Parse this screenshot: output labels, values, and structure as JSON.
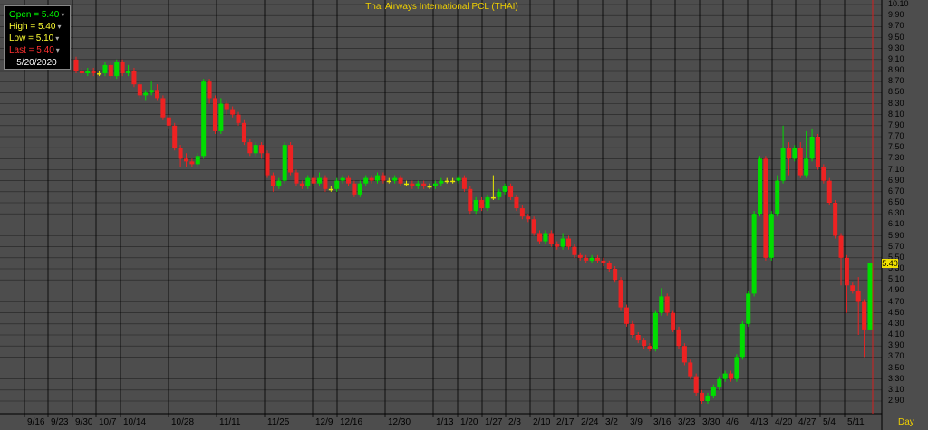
{
  "title": "Thai Airways International PCL (THAI)",
  "info": {
    "open": "Open = 5.40",
    "high": "High = 5.40",
    "low": "Low = 5.10",
    "last": "Last = 5.40",
    "date": "5/20/2020"
  },
  "colors": {
    "background": "#4d4d4d",
    "grid": "#000000",
    "up": "#00dd00",
    "down": "#ee2222",
    "doji": "#e8e800",
    "open": "#00ff00",
    "high": "#ffff33",
    "low": "#ffff33",
    "last": "#ff3030"
  },
  "period_label": "Day",
  "last_price_badge": "5.40",
  "chart_data": {
    "type": "candlestick",
    "title": "Thai Airways International PCL (THAI)",
    "ylim": [
      2.8,
      10.1
    ],
    "y_ticks": [
      "10.10",
      "9.90",
      "9.70",
      "9.50",
      "9.30",
      "9.10",
      "8.90",
      "8.70",
      "8.50",
      "8.30",
      "8.10",
      "7.90",
      "7.70",
      "7.50",
      "7.30",
      "7.10",
      "6.90",
      "6.70",
      "6.50",
      "6.30",
      "6.10",
      "5.90",
      "5.70",
      "5.50",
      "5.30",
      "5.10",
      "4.90",
      "4.70",
      "4.50",
      "4.30",
      "4.10",
      "3.90",
      "3.70",
      "3.50",
      "3.30",
      "3.10",
      "2.90"
    ],
    "x_ticks": [
      "9/16",
      "9/23",
      "9/30",
      "10/7",
      "10/14",
      "10/28",
      "11/11",
      "11/25",
      "12/9",
      "12/16",
      "12/30",
      "1/13",
      "1/20",
      "1/27",
      "2/3",
      "2/10",
      "2/17",
      "2/24",
      "3/2",
      "3/9",
      "3/16",
      "3/23",
      "3/30",
      "4/6",
      "4/13",
      "4/20",
      "4/27",
      "5/4",
      "5/11"
    ],
    "candles": [
      [
        9.1,
        8.9,
        9.15,
        8.85
      ],
      [
        8.9,
        8.85,
        8.95,
        8.8
      ],
      [
        8.85,
        8.9,
        8.95,
        8.8
      ],
      [
        8.9,
        8.85,
        8.95,
        8.8
      ],
      [
        8.85,
        8.85,
        8.9,
        8.8
      ],
      [
        8.85,
        9.0,
        9.05,
        8.8
      ],
      [
        9.0,
        8.8,
        9.05,
        8.75
      ],
      [
        8.8,
        9.05,
        9.1,
        8.75
      ],
      [
        9.05,
        8.85,
        9.1,
        8.8
      ],
      [
        8.85,
        8.9,
        9.0,
        8.8
      ],
      [
        8.9,
        8.65,
        8.95,
        8.6
      ],
      [
        8.65,
        8.45,
        8.7,
        8.4
      ],
      [
        8.45,
        8.5,
        8.55,
        8.35
      ],
      [
        8.5,
        8.55,
        8.7,
        8.45
      ],
      [
        8.55,
        8.4,
        8.65,
        8.35
      ],
      [
        8.4,
        8.05,
        8.45,
        8.0
      ],
      [
        8.05,
        7.9,
        8.1,
        7.85
      ],
      [
        7.9,
        7.5,
        7.95,
        7.45
      ],
      [
        7.5,
        7.3,
        7.55,
        7.15
      ],
      [
        7.3,
        7.25,
        7.4,
        7.15
      ],
      [
        7.25,
        7.2,
        7.3,
        7.15
      ],
      [
        7.2,
        7.35,
        7.4,
        7.15
      ],
      [
        7.35,
        8.7,
        8.75,
        7.3
      ],
      [
        8.7,
        8.4,
        8.75,
        8.3
      ],
      [
        8.4,
        7.8,
        8.45,
        7.75
      ],
      [
        7.8,
        8.3,
        8.4,
        7.75
      ],
      [
        8.3,
        8.2,
        8.35,
        8.1
      ],
      [
        8.2,
        8.1,
        8.25,
        8.05
      ],
      [
        8.1,
        7.95,
        8.15,
        7.9
      ],
      [
        7.95,
        7.6,
        8.0,
        7.55
      ],
      [
        7.6,
        7.4,
        7.65,
        7.35
      ],
      [
        7.4,
        7.55,
        7.6,
        7.35
      ],
      [
        7.55,
        7.4,
        7.6,
        7.3
      ],
      [
        7.4,
        7.0,
        7.45,
        6.95
      ],
      [
        7.0,
        6.8,
        7.05,
        6.7
      ],
      [
        6.8,
        6.9,
        6.95,
        6.75
      ],
      [
        6.9,
        7.55,
        7.6,
        6.85
      ],
      [
        7.55,
        7.05,
        7.6,
        7.0
      ],
      [
        7.05,
        6.85,
        7.1,
        6.8
      ],
      [
        6.85,
        6.8,
        6.9,
        6.75
      ],
      [
        6.8,
        6.95,
        7.0,
        6.75
      ],
      [
        6.95,
        6.85,
        7.0,
        6.8
      ],
      [
        6.85,
        6.95,
        7.05,
        6.8
      ],
      [
        6.95,
        6.75,
        7.0,
        6.7
      ],
      [
        6.75,
        6.75,
        6.8,
        6.7
      ],
      [
        6.75,
        6.9,
        6.95,
        6.7
      ],
      [
        6.9,
        6.95,
        7.0,
        6.85
      ],
      [
        6.95,
        6.85,
        7.0,
        6.8
      ],
      [
        6.85,
        6.65,
        6.9,
        6.6
      ],
      [
        6.65,
        6.85,
        6.9,
        6.6
      ],
      [
        6.85,
        6.95,
        7.0,
        6.8
      ],
      [
        6.95,
        6.9,
        7.0,
        6.85
      ],
      [
        6.9,
        7.0,
        7.05,
        6.85
      ],
      [
        7.0,
        6.9,
        7.05,
        6.85
      ],
      [
        6.9,
        6.9,
        6.95,
        6.85
      ],
      [
        6.9,
        6.95,
        7.0,
        6.85
      ],
      [
        6.95,
        6.85,
        7.0,
        6.8
      ],
      [
        6.85,
        6.85,
        6.9,
        6.8
      ],
      [
        6.85,
        6.8,
        6.9,
        6.75
      ],
      [
        6.8,
        6.85,
        6.9,
        6.75
      ],
      [
        6.85,
        6.8,
        6.9,
        6.75
      ],
      [
        6.8,
        6.8,
        6.85,
        6.75
      ],
      [
        6.8,
        6.85,
        6.9,
        6.75
      ],
      [
        6.85,
        6.9,
        6.95,
        6.8
      ],
      [
        6.9,
        6.9,
        6.95,
        6.85
      ],
      [
        6.9,
        6.9,
        6.95,
        6.85
      ],
      [
        6.9,
        6.95,
        7.0,
        6.85
      ],
      [
        6.95,
        6.75,
        7.0,
        6.7
      ],
      [
        6.75,
        6.35,
        6.8,
        6.3
      ],
      [
        6.35,
        6.55,
        6.6,
        6.3
      ],
      [
        6.55,
        6.4,
        6.6,
        6.35
      ],
      [
        6.4,
        6.6,
        6.65,
        6.35
      ],
      [
        6.6,
        6.6,
        7.0,
        6.55
      ],
      [
        6.6,
        6.7,
        6.75,
        6.55
      ],
      [
        6.7,
        6.8,
        6.85,
        6.65
      ],
      [
        6.8,
        6.6,
        6.85,
        6.55
      ],
      [
        6.6,
        6.4,
        6.65,
        6.35
      ],
      [
        6.4,
        6.25,
        6.45,
        6.2
      ],
      [
        6.25,
        6.2,
        6.3,
        6.15
      ],
      [
        6.2,
        5.95,
        6.25,
        5.9
      ],
      [
        5.95,
        5.8,
        6.0,
        5.75
      ],
      [
        5.8,
        5.95,
        6.0,
        5.75
      ],
      [
        5.95,
        5.75,
        6.0,
        5.7
      ],
      [
        5.75,
        5.7,
        5.8,
        5.65
      ],
      [
        5.7,
        5.85,
        5.95,
        5.65
      ],
      [
        5.85,
        5.7,
        5.9,
        5.65
      ],
      [
        5.7,
        5.55,
        5.75,
        5.5
      ],
      [
        5.55,
        5.5,
        5.6,
        5.45
      ],
      [
        5.5,
        5.45,
        5.55,
        5.4
      ],
      [
        5.45,
        5.5,
        5.55,
        5.4
      ],
      [
        5.5,
        5.45,
        5.55,
        5.4
      ],
      [
        5.45,
        5.4,
        5.5,
        5.35
      ],
      [
        5.4,
        5.3,
        5.45,
        5.25
      ],
      [
        5.3,
        5.1,
        5.35,
        5.05
      ],
      [
        5.1,
        4.6,
        5.15,
        4.55
      ],
      [
        4.6,
        4.3,
        4.65,
        4.25
      ],
      [
        4.3,
        4.1,
        4.35,
        4.05
      ],
      [
        4.1,
        4.0,
        4.15,
        3.95
      ],
      [
        4.0,
        3.9,
        4.05,
        3.85
      ],
      [
        3.9,
        3.85,
        3.95,
        3.8
      ],
      [
        3.85,
        4.5,
        4.55,
        3.8
      ],
      [
        4.5,
        4.8,
        4.95,
        4.45
      ],
      [
        4.8,
        4.5,
        4.85,
        4.45
      ],
      [
        4.5,
        4.2,
        4.55,
        4.15
      ],
      [
        4.2,
        3.9,
        4.25,
        3.85
      ],
      [
        3.9,
        3.6,
        3.95,
        3.55
      ],
      [
        3.6,
        3.35,
        3.65,
        3.3
      ],
      [
        3.35,
        3.05,
        3.4,
        3.0
      ],
      [
        3.05,
        2.9,
        3.1,
        2.85
      ],
      [
        2.9,
        3.0,
        3.05,
        2.85
      ],
      [
        3.0,
        3.15,
        3.2,
        2.95
      ],
      [
        3.15,
        3.3,
        3.35,
        3.1
      ],
      [
        3.3,
        3.4,
        3.45,
        3.25
      ],
      [
        3.4,
        3.3,
        3.45,
        3.25
      ],
      [
        3.3,
        3.7,
        3.75,
        3.25
      ],
      [
        3.7,
        4.3,
        4.35,
        3.65
      ],
      [
        4.3,
        4.85,
        4.9,
        4.25
      ],
      [
        4.85,
        6.3,
        6.35,
        4.8
      ],
      [
        6.3,
        7.3,
        7.35,
        6.25
      ],
      [
        7.3,
        5.5,
        7.35,
        5.45
      ],
      [
        5.5,
        6.3,
        6.35,
        5.45
      ],
      [
        6.3,
        6.9,
        7.0,
        6.25
      ],
      [
        6.9,
        7.5,
        7.9,
        6.85
      ],
      [
        7.5,
        7.3,
        7.6,
        7.0
      ],
      [
        7.3,
        7.5,
        7.55,
        7.25
      ],
      [
        7.5,
        7.0,
        7.6,
        6.95
      ],
      [
        7.0,
        7.3,
        7.8,
        6.95
      ],
      [
        7.3,
        7.7,
        7.85,
        7.25
      ],
      [
        7.7,
        7.15,
        7.75,
        7.1
      ],
      [
        7.15,
        6.9,
        7.2,
        6.85
      ],
      [
        6.9,
        6.5,
        6.95,
        6.45
      ],
      [
        6.5,
        5.9,
        6.55,
        5.85
      ],
      [
        5.9,
        5.5,
        5.95,
        5.0
      ],
      [
        5.5,
        5.0,
        5.55,
        4.5
      ],
      [
        5.0,
        4.9,
        5.05,
        4.85
      ],
      [
        4.9,
        4.7,
        5.15,
        4.1
      ],
      [
        4.7,
        4.2,
        4.75,
        3.7
      ],
      [
        4.2,
        5.4,
        5.4,
        5.1
      ]
    ]
  }
}
